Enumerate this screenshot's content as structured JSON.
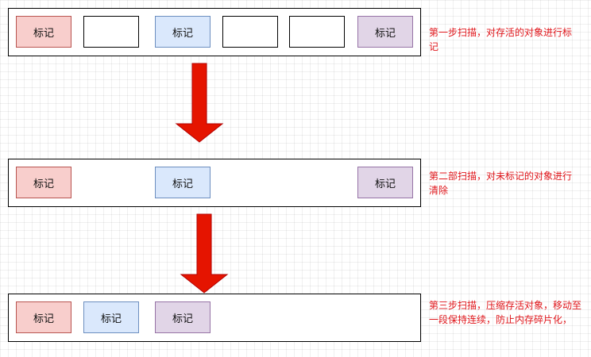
{
  "colors": {
    "marked_red": "#f8cecc",
    "marked_blue": "#dae8fc",
    "marked_purple": "#e1d5e7",
    "arrow": "#e51400",
    "note_text": "#e0161b"
  },
  "cell_label": "标记",
  "steps": [
    {
      "note": "第一步扫描，对存活的对象进行标记"
    },
    {
      "note": "第二部扫描，对未标记的对象进行清除"
    },
    {
      "note": "第三步扫描，压缩存活对象，移动至一段保持连续，防止内存碎片化，"
    }
  ]
}
